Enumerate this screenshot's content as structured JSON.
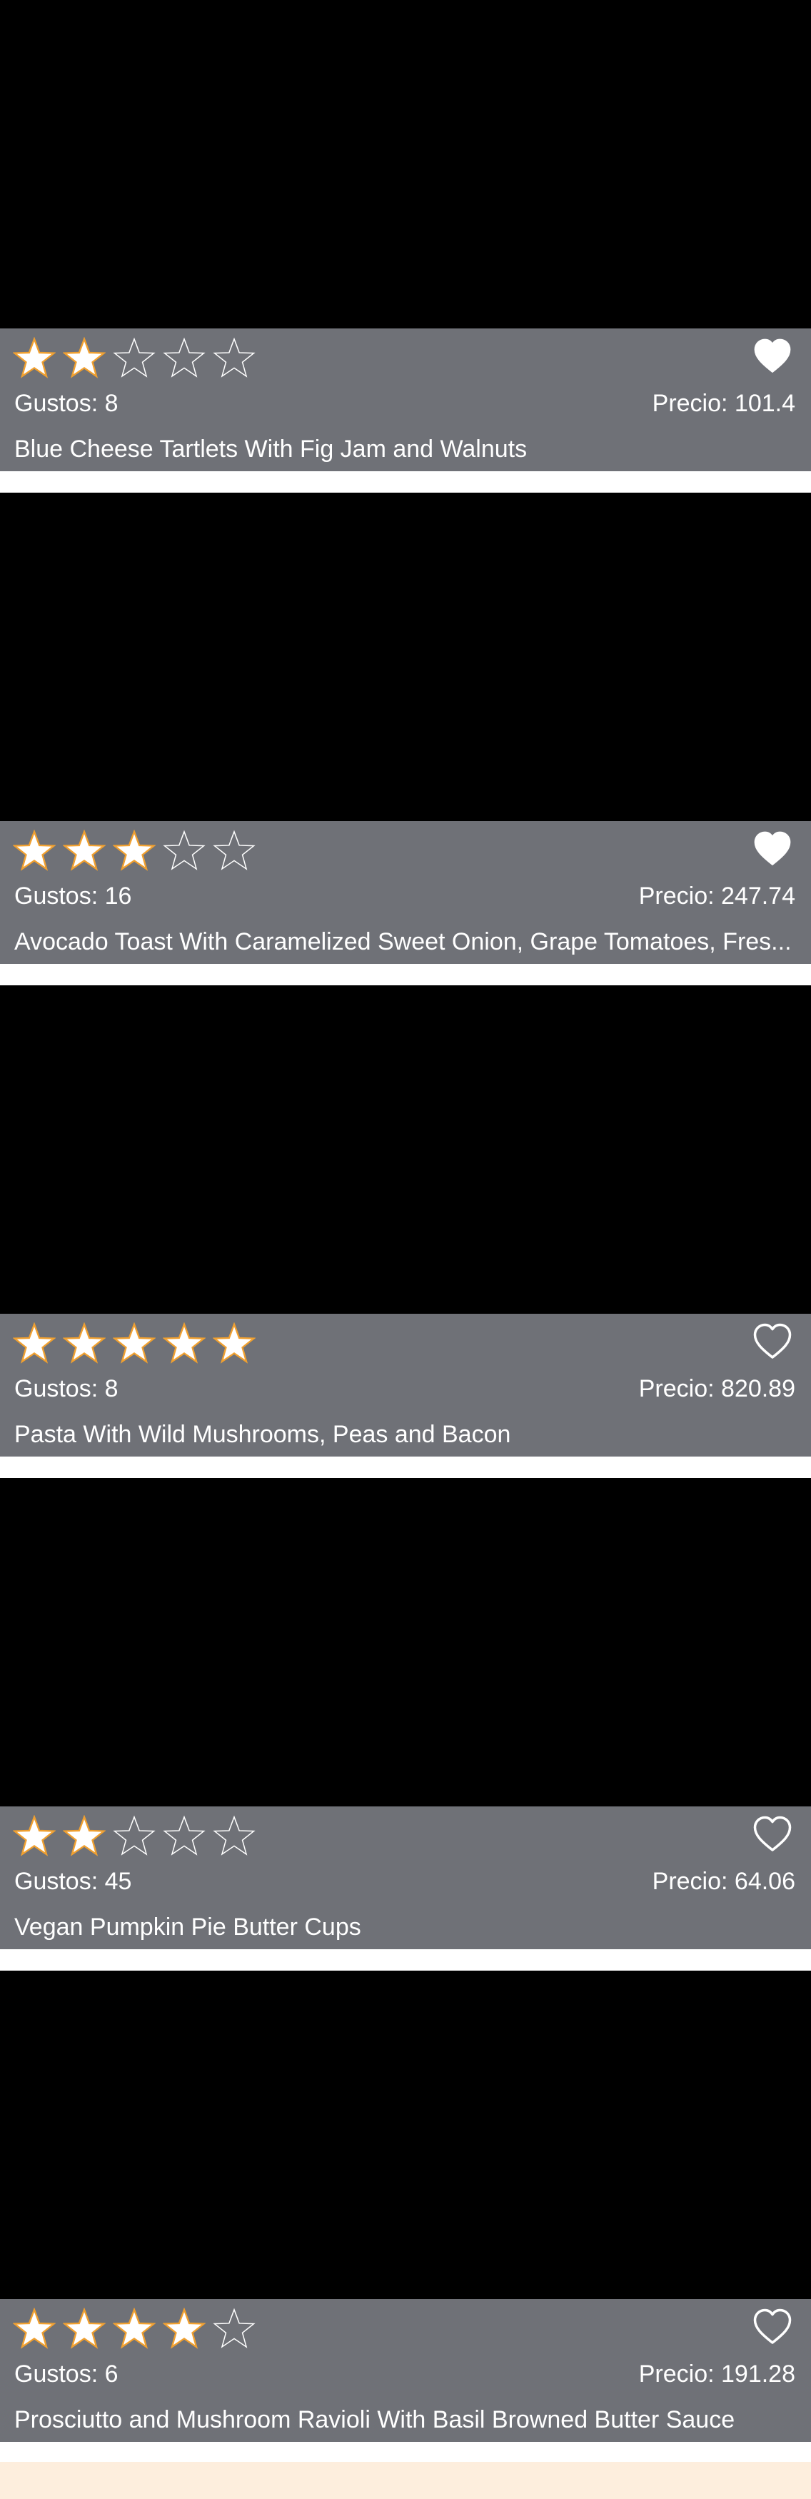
{
  "colors": {
    "card_info_bg": "#6f7177",
    "image_bg": "#000000",
    "star_filled": "#ffffff",
    "star_outline": "#f0a030",
    "text": "#ffffff",
    "bottom_strip": "#fdeedd"
  },
  "icons": {
    "star": "star-icon",
    "heart_filled": "heart-filled-icon",
    "heart_outline": "heart-outline-icon"
  },
  "recipes": [
    {
      "rating": 2,
      "rating_max": 5,
      "favorite": true,
      "likes": "Gustos: 8",
      "price": "Precio: 101.4",
      "title": "Blue Cheese Tartlets With Fig Jam and Walnuts"
    },
    {
      "rating": 3,
      "rating_max": 5,
      "favorite": true,
      "likes": "Gustos: 16",
      "price": "Precio: 247.74",
      "title": "Avocado Toast With Caramelized Sweet Onion, Grape Tomatoes, Fres..."
    },
    {
      "rating": 5,
      "rating_max": 5,
      "favorite": false,
      "likes": "Gustos: 8",
      "price": "Precio: 820.89",
      "title": "Pasta With Wild Mushrooms, Peas and Bacon"
    },
    {
      "rating": 2,
      "rating_max": 5,
      "favorite": false,
      "likes": "Gustos: 45",
      "price": "Precio: 64.06",
      "title": "Vegan Pumpkin Pie Butter Cups"
    },
    {
      "rating": 4,
      "rating_max": 5,
      "favorite": false,
      "likes": "Gustos: 6",
      "price": "Precio: 191.28",
      "title": "Prosciutto and Mushroom Ravioli With Basil Browned Butter Sauce"
    }
  ]
}
